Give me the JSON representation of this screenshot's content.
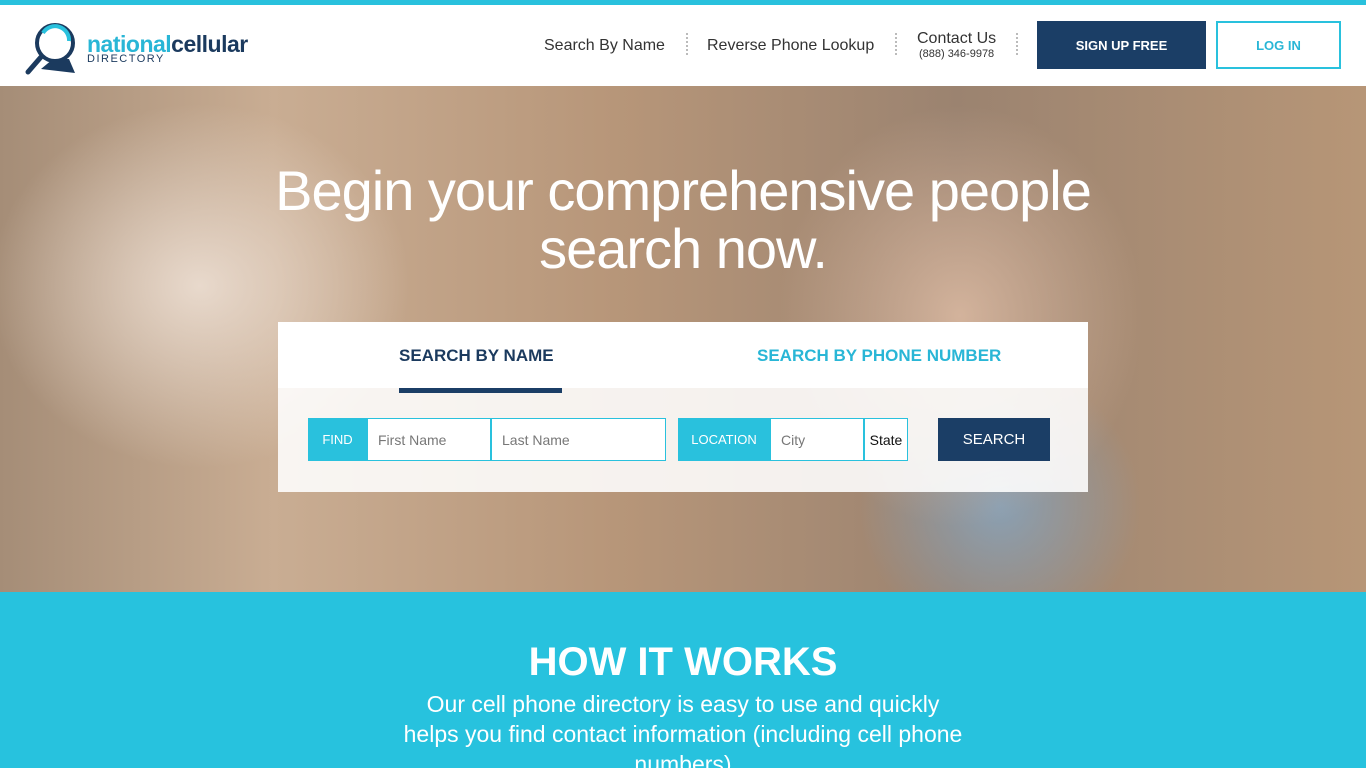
{
  "header": {
    "logo_primary": "national",
    "logo_secondary": "cellular",
    "logo_sub": "DIRECTORY",
    "nav": [
      "Search By Name",
      "Reverse Phone Lookup"
    ],
    "contact_label": "Contact Us",
    "contact_phone": "(888) 346-9978",
    "signup_label": "SIGN UP FREE",
    "login_label": "LOG IN"
  },
  "hero": {
    "headline_line1": "Begin your comprehensive people",
    "headline_line2": "search now.",
    "tabs": [
      {
        "label": "SEARCH BY NAME",
        "active": true
      },
      {
        "label": "SEARCH BY PHONE NUMBER",
        "active": false
      }
    ],
    "find_label": "FIND",
    "first_name_placeholder": "First Name",
    "last_name_placeholder": "Last Name",
    "location_label": "LOCATION",
    "city_placeholder": "City",
    "state_value": "State",
    "search_label": "SEARCH"
  },
  "how": {
    "title": "HOW IT WORKS",
    "text": "Our cell phone directory is easy to use and quickly helps you find contact information (including cell phone numbers)"
  },
  "colors": {
    "accent": "#29c1dd",
    "navy": "#1b3e66"
  }
}
